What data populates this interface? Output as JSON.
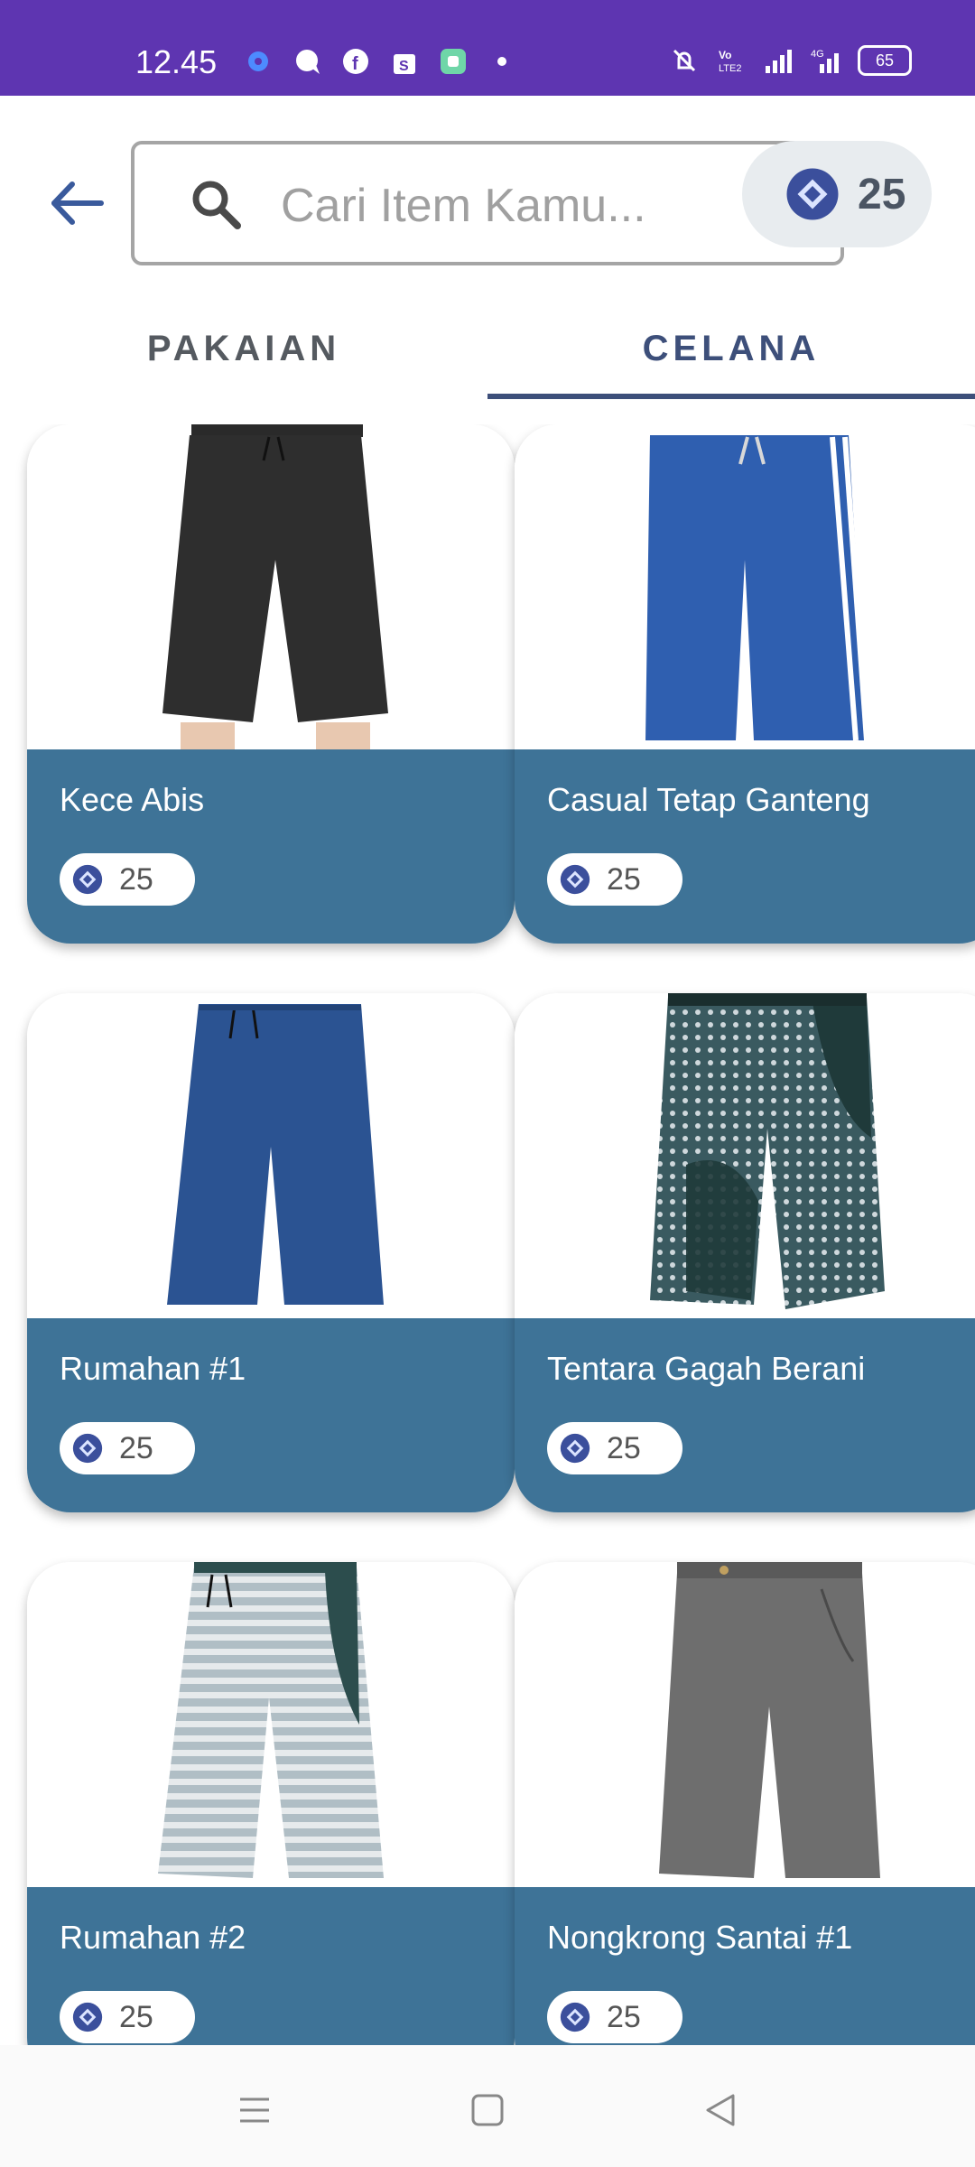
{
  "status_bar": {
    "time": "12.45",
    "battery": "65",
    "icons_left": [
      "settings-icon",
      "chat-icon",
      "facebook-icon",
      "shop-icon",
      "app-icon",
      "dot-icon"
    ],
    "icons_right": [
      "mute-icon",
      "volte-icon",
      "signal-icon",
      "4g-signal-icon"
    ]
  },
  "header": {
    "search_placeholder": "Cari Item Kamu...",
    "coin_balance": "25"
  },
  "tabs": [
    {
      "label": "PAKAIAN",
      "selected": false
    },
    {
      "label": "CELANA",
      "selected": true
    }
  ],
  "colors": {
    "status_bar": "#5e35b1",
    "accent": "#3d4f7a",
    "card_info": "#3e7397",
    "coin": "#3b4f9c"
  },
  "items": [
    {
      "name": "Kece Abis",
      "price": "25",
      "image": "black-shorts"
    },
    {
      "name": "Casual Tetap Ganteng",
      "price": "25",
      "image": "blue-striped-shorts"
    },
    {
      "name": "Rumahan #1",
      "price": "25",
      "image": "denim-shorts"
    },
    {
      "name": "Tentara Gagah Berani",
      "price": "25",
      "image": "dotted-shorts"
    },
    {
      "name": "Rumahan #2",
      "price": "25",
      "image": "striped-shorts"
    },
    {
      "name": "Nongkrong Santai #1",
      "price": "25",
      "image": "grey-shorts"
    }
  ],
  "nav_bar": [
    "menu-icon",
    "home-icon",
    "back-icon"
  ]
}
